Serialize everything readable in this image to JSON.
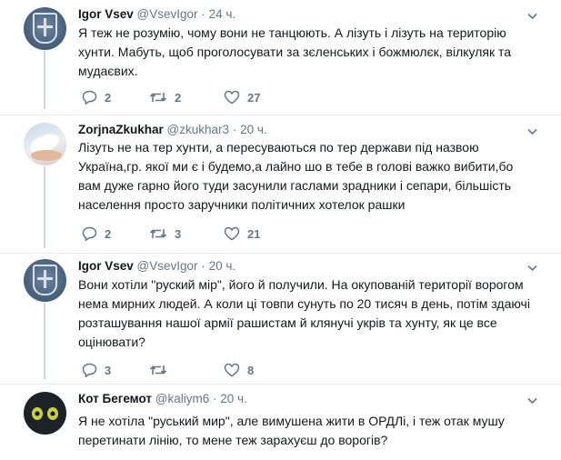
{
  "tweets": [
    {
      "name": "Igor Vsev",
      "handle": "@VsevIgor",
      "separator": "·",
      "time": "24 ч.",
      "lines": [
        "Я теж не розумію, чому вони не танцюють. А лізуть і лізуть на територію",
        "хунти. Мабуть, щоб проголосувати за зєленських і божмюлєк, вілкуляк та",
        "мудаєвих."
      ],
      "replies": "2",
      "retweets": "2",
      "likes": "27",
      "avatar_icon": "government-crest-avatar"
    },
    {
      "name": "ZorjnaZkukhar",
      "handle": "@zkukhar3",
      "separator": "·",
      "time": "20 ч.",
      "lines": [
        "Лізуть не на тер хунти, а пересуваються по тер держави під назвою",
        "Україна,гр. якої ми є і будемо,а лайно шо в тебе в голові важко вибити,бо",
        "вам дуже гарно його туди засунили гаслами зрадники і сепари, більшість",
        "населення просто заручники політичних хотелок рашки"
      ],
      "replies": "2",
      "retweets": "3",
      "likes": "21",
      "avatar_icon": "dove-avatar"
    },
    {
      "name": "Igor Vsev",
      "handle": "@VsevIgor",
      "separator": "·",
      "time": "20 ч.",
      "lines": [
        "Вони хотіли \"руский мір\", його й получили. На окупованій території ворогом",
        "нема мирних людей. А коли ці товпи сунуть по 20 тисяч в день, потім здаючі",
        "розташування нашої армії рашистам й клянучі укрів та хунту, як це все",
        "оцінювати?"
      ],
      "replies": "3",
      "retweets": "",
      "likes": "8",
      "avatar_icon": "government-crest-avatar"
    },
    {
      "name": "Кот Бегемот",
      "handle": "@kaliym6",
      "separator": "·",
      "time": "20 ч.",
      "lines": [
        "Я не хотіла \"руський мир\", але вимушена жити в ОРДЛі, і теж отак мушу",
        "перетинати лінію, то мене теж зарахуєш до ворогів?"
      ],
      "avatar_icon": "cat-avatar"
    }
  ],
  "colors": {
    "text": "#14171a",
    "muted": "#657786",
    "separator": "#e6ecf0",
    "highlight_bg": "#f5f8fa",
    "thread_line": "#ccd6dd"
  }
}
